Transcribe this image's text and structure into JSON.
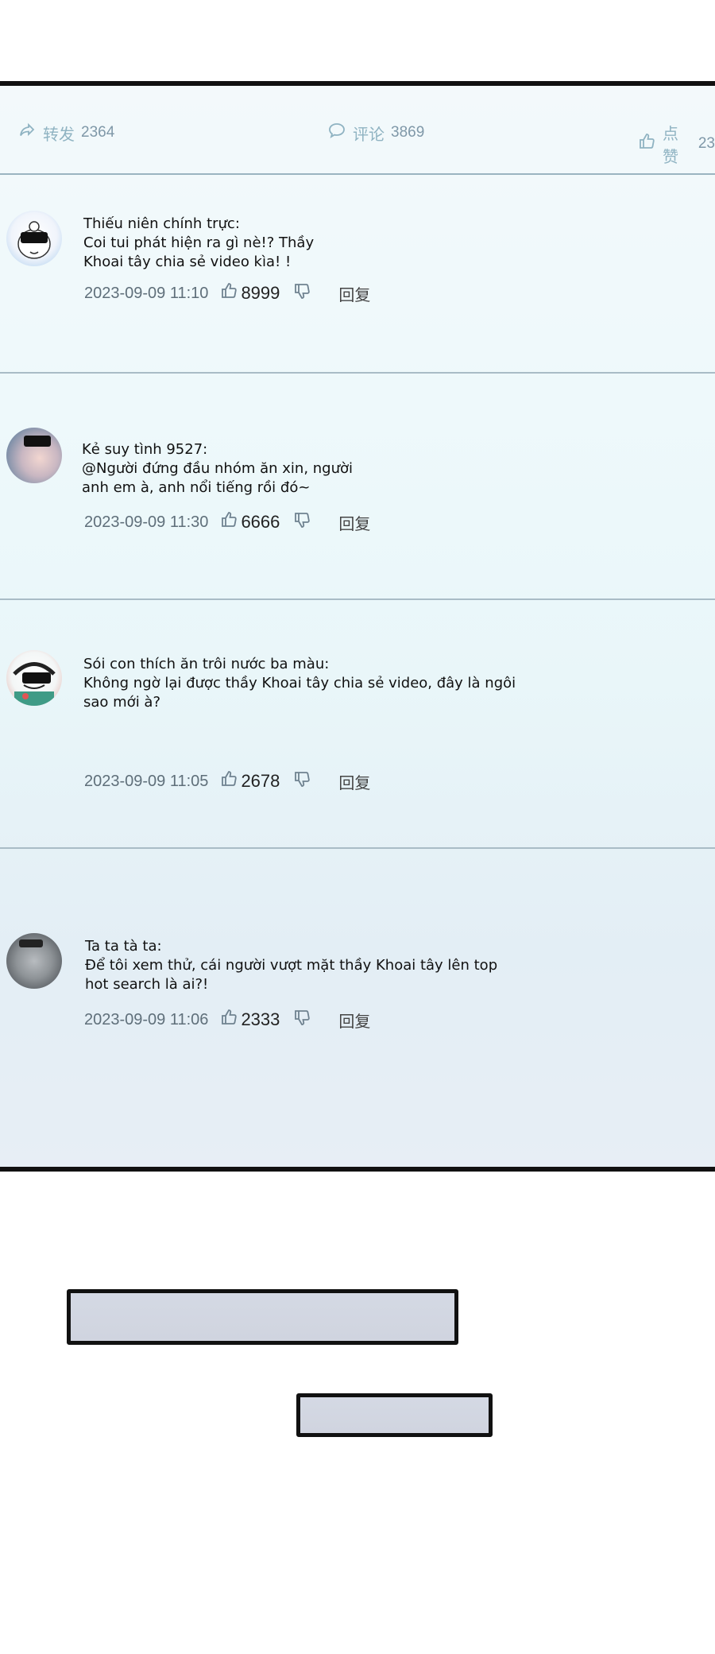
{
  "stats": {
    "repost_label": "转发",
    "repost_count": "2364",
    "comment_label": "评论",
    "comment_count": "3869",
    "like_label": "点赞",
    "like_count": "23"
  },
  "comments": [
    {
      "author": "Thiếu niên chính trực:",
      "text": "Coi tui phát hiện ra gì nè!? Thầy\nKhoai tây chia sẻ video kìa! !",
      "date": "2023-09-09 11:10",
      "likes": "8999",
      "reply": "回复"
    },
    {
      "author": "Kẻ suy tình 9527:",
      "text": "@Người đứng đầu nhóm ăn xin, người\nanh em à, anh nổi tiếng rồi đó~",
      "date": "2023-09-09   11:30",
      "likes": "6666",
      "reply": "回复"
    },
    {
      "author": "Sói con thích ăn trôi nước ba màu:",
      "text": "Không ngờ lại được thầy Khoai tây chia sẻ video, đây là ngôi\nsao mới à?",
      "date": "2023-09-09   11:05",
      "likes": "2678",
      "reply": "回复"
    },
    {
      "author": "Ta ta tà ta:",
      "text": "Để tôi xem thử, cái người vượt mặt thầy Khoai tây lên top\nhot search là ai?!",
      "date": "2023-09-09   11:06",
      "likes": "2333",
      "reply": "回复"
    }
  ],
  "colors": {
    "panel_border": "#111111",
    "divider": "#a9bcc6",
    "stat_text": "#8fb3c2",
    "box_fill": "#d2d6e1"
  },
  "icons": [
    "share-icon",
    "comment-bubble-icon",
    "thumbs-up-icon",
    "thumbs-down-icon"
  ]
}
